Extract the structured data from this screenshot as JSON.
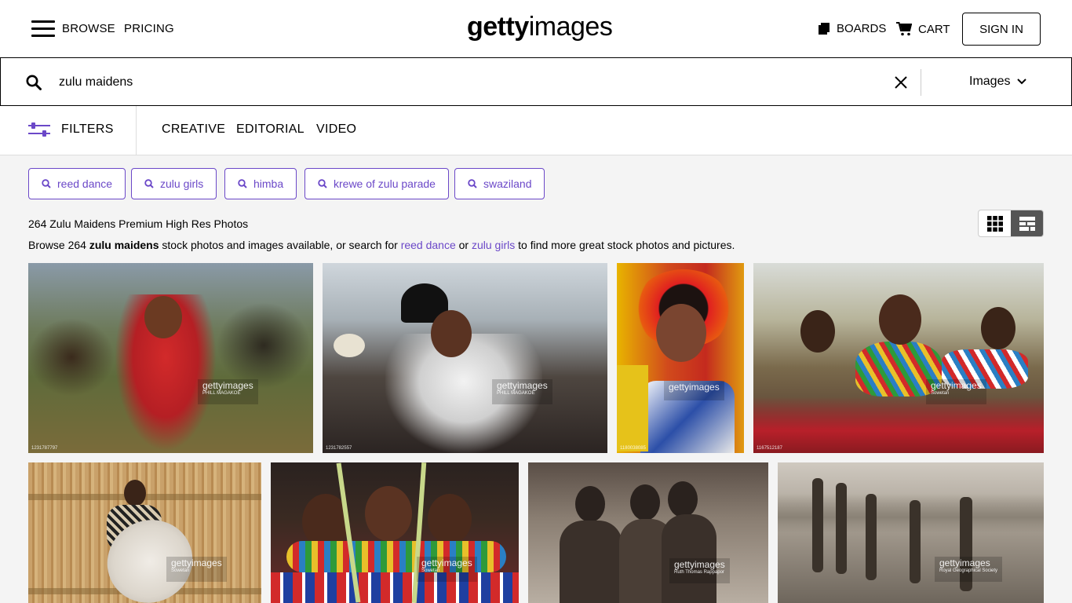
{
  "header": {
    "browse": "BROWSE",
    "pricing": "PRICING",
    "logo_bold": "getty",
    "logo_light": "images",
    "boards": "BOARDS",
    "cart": "CART",
    "sign_in": "SIGN IN"
  },
  "search": {
    "value": "zulu maidens",
    "type_label": "Images"
  },
  "filterbar": {
    "filters": "FILTERS",
    "tabs": [
      "CREATIVE",
      "EDITORIAL",
      "VIDEO"
    ]
  },
  "related": [
    "reed dance",
    "zulu girls",
    "himba",
    "krewe of zulu parade",
    "swaziland"
  ],
  "results": {
    "count_line": "264 Zulu Maidens Premium High Res Photos",
    "desc_prefix": "Browse 264 ",
    "desc_term": "zulu maidens",
    "desc_mid": " stock photos and images available, or search for ",
    "link1": "reed dance",
    "desc_or": " or ",
    "link2": "zulu girls",
    "desc_suffix": " to find more great stock photos and pictures."
  },
  "images": [
    {
      "watermark": "gettyimages",
      "credit": "PHILL MAGAKOE",
      "id": "1231787797"
    },
    {
      "watermark": "gettyimages",
      "credit": "PHILL MAGAKOE",
      "id": "1231782557"
    },
    {
      "watermark": "gettyimages",
      "credit": "",
      "id": "1180038085"
    },
    {
      "watermark": "gettyimages",
      "credit": "Sowetan",
      "id": "1167512187"
    },
    {
      "watermark": "gettyimages",
      "credit": "Sowetan",
      "id": ""
    },
    {
      "watermark": "gettyimages",
      "credit": "Sowetan",
      "id": ""
    },
    {
      "watermark": "gettyimages",
      "credit": "Ruth Thomas Rappapor",
      "id": ""
    },
    {
      "watermark": "gettyimages",
      "credit": "Royal Geographical Society",
      "id": ""
    }
  ],
  "colors": {
    "accent": "#6b48c8"
  }
}
